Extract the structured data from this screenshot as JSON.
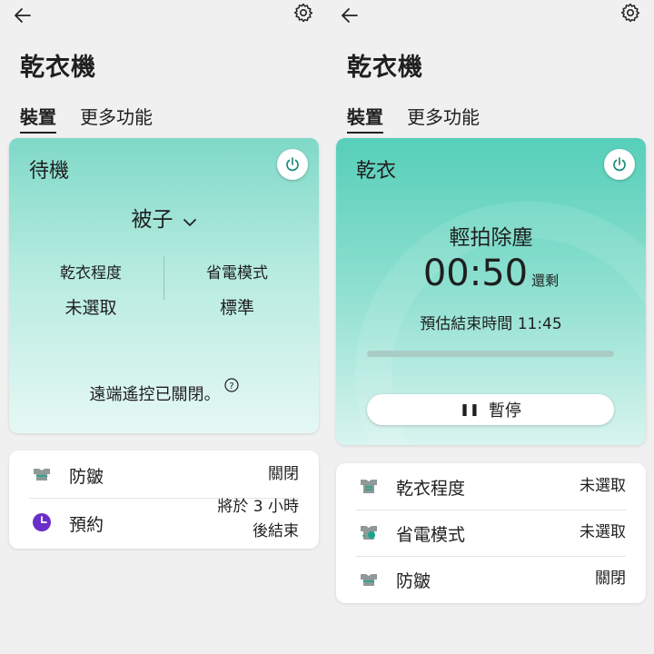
{
  "left": {
    "title": "乾衣機",
    "tabs": {
      "device": "裝置",
      "more": "更多功能"
    },
    "status": "待機",
    "course": "被子",
    "stats": [
      {
        "label": "乾衣程度",
        "value": "未選取"
      },
      {
        "label": "省電模式",
        "value": "標準"
      }
    ],
    "remote_text": "遠端遙控已關閉。",
    "options": [
      {
        "icon": "anti-wrinkle-icon",
        "label": "防皺",
        "value": "關閉"
      },
      {
        "icon": "schedule-clock-icon",
        "label": "預約",
        "value_line1": "將於 3 小時",
        "value_line2": "後結束"
      }
    ]
  },
  "right": {
    "title": "乾衣機",
    "tabs": {
      "device": "裝置",
      "more": "更多功能"
    },
    "status": "乾衣",
    "cycle": "輕拍除塵",
    "time": "00:50",
    "time_suffix": "還剩",
    "eta": "預估結束時間 11:45",
    "progress_fraction": 0.0,
    "pause_label": "暫停",
    "options": [
      {
        "icon": "dryness-level-icon",
        "label": "乾衣程度",
        "value": "未選取"
      },
      {
        "icon": "eco-mode-icon",
        "label": "省電模式",
        "value": "未選取"
      },
      {
        "icon": "anti-wrinkle-icon",
        "label": "防皺",
        "value": "關閉"
      }
    ]
  },
  "colors": {
    "accent": "#6a2ec9",
    "mint": "#7fd9c8",
    "mint_dark": "#56cfb9",
    "text": "#1f1f1f"
  }
}
